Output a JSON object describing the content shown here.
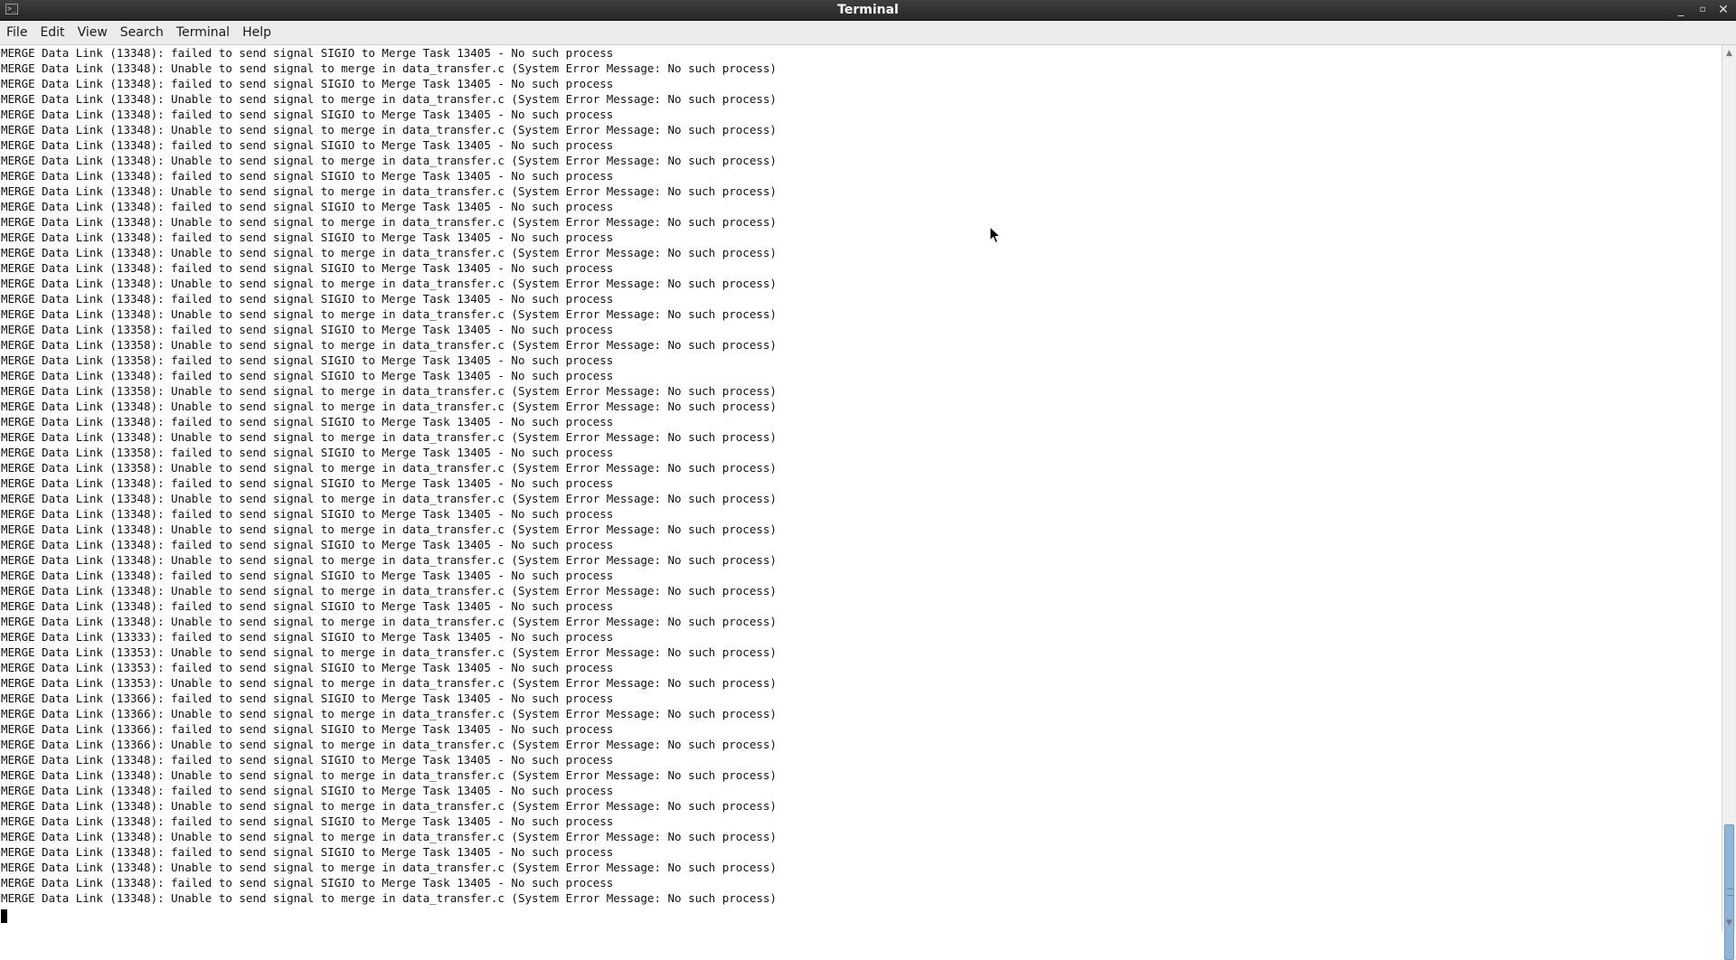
{
  "window": {
    "title": "Terminal",
    "app_icon": ">_",
    "buttons": {
      "minimize": "_",
      "maximize": "▫",
      "close": "✕"
    }
  },
  "menu": [
    "File",
    "Edit",
    "View",
    "Search",
    "Terminal",
    "Help"
  ],
  "terminal": {
    "lines": [
      "MERGE Data Link (13348): failed to send signal SIGIO to Merge Task 13405 - No such process",
      "MERGE Data Link (13348): Unable to send signal to merge in data_transfer.c (System Error Message: No such process)",
      "MERGE Data Link (13348): failed to send signal SIGIO to Merge Task 13405 - No such process",
      "MERGE Data Link (13348): Unable to send signal to merge in data_transfer.c (System Error Message: No such process)",
      "MERGE Data Link (13348): failed to send signal SIGIO to Merge Task 13405 - No such process",
      "MERGE Data Link (13348): Unable to send signal to merge in data_transfer.c (System Error Message: No such process)",
      "MERGE Data Link (13348): failed to send signal SIGIO to Merge Task 13405 - No such process",
      "MERGE Data Link (13348): Unable to send signal to merge in data_transfer.c (System Error Message: No such process)",
      "MERGE Data Link (13348): failed to send signal SIGIO to Merge Task 13405 - No such process",
      "MERGE Data Link (13348): Unable to send signal to merge in data_transfer.c (System Error Message: No such process)",
      "MERGE Data Link (13348): failed to send signal SIGIO to Merge Task 13405 - No such process",
      "MERGE Data Link (13348): Unable to send signal to merge in data_transfer.c (System Error Message: No such process)",
      "MERGE Data Link (13348): failed to send signal SIGIO to Merge Task 13405 - No such process",
      "MERGE Data Link (13348): Unable to send signal to merge in data_transfer.c (System Error Message: No such process)",
      "MERGE Data Link (13348): failed to send signal SIGIO to Merge Task 13405 - No such process",
      "MERGE Data Link (13348): Unable to send signal to merge in data_transfer.c (System Error Message: No such process)",
      "MERGE Data Link (13348): failed to send signal SIGIO to Merge Task 13405 - No such process",
      "MERGE Data Link (13348): Unable to send signal to merge in data_transfer.c (System Error Message: No such process)",
      "MERGE Data Link (13358): failed to send signal SIGIO to Merge Task 13405 - No such process",
      "MERGE Data Link (13358): Unable to send signal to merge in data_transfer.c (System Error Message: No such process)",
      "MERGE Data Link (13358): failed to send signal SIGIO to Merge Task 13405 - No such process",
      "MERGE Data Link (13348): failed to send signal SIGIO to Merge Task 13405 - No such process",
      "MERGE Data Link (13358): Unable to send signal to merge in data_transfer.c (System Error Message: No such process)",
      "MERGE Data Link (13348): Unable to send signal to merge in data_transfer.c (System Error Message: No such process)",
      "MERGE Data Link (13348): failed to send signal SIGIO to Merge Task 13405 - No such process",
      "MERGE Data Link (13348): Unable to send signal to merge in data_transfer.c (System Error Message: No such process)",
      "MERGE Data Link (13358): failed to send signal SIGIO to Merge Task 13405 - No such process",
      "MERGE Data Link (13358): Unable to send signal to merge in data_transfer.c (System Error Message: No such process)",
      "MERGE Data Link (13348): failed to send signal SIGIO to Merge Task 13405 - No such process",
      "MERGE Data Link (13348): Unable to send signal to merge in data_transfer.c (System Error Message: No such process)",
      "MERGE Data Link (13348): failed to send signal SIGIO to Merge Task 13405 - No such process",
      "MERGE Data Link (13348): Unable to send signal to merge in data_transfer.c (System Error Message: No such process)",
      "MERGE Data Link (13348): failed to send signal SIGIO to Merge Task 13405 - No such process",
      "MERGE Data Link (13348): Unable to send signal to merge in data_transfer.c (System Error Message: No such process)",
      "MERGE Data Link (13348): failed to send signal SIGIO to Merge Task 13405 - No such process",
      "MERGE Data Link (13348): Unable to send signal to merge in data_transfer.c (System Error Message: No such process)",
      "MERGE Data Link (13348): failed to send signal SIGIO to Merge Task 13405 - No such process",
      "MERGE Data Link (13348): Unable to send signal to merge in data_transfer.c (System Error Message: No such process)",
      "MERGE Data Link (13333): failed to send signal SIGIO to Merge Task 13405 - No such process",
      "MERGE Data Link (13353): Unable to send signal to merge in data_transfer.c (System Error Message: No such process)",
      "MERGE Data Link (13353): failed to send signal SIGIO to Merge Task 13405 - No such process",
      "MERGE Data Link (13353): Unable to send signal to merge in data_transfer.c (System Error Message: No such process)",
      "MERGE Data Link (13366): failed to send signal SIGIO to Merge Task 13405 - No such process",
      "MERGE Data Link (13366): Unable to send signal to merge in data_transfer.c (System Error Message: No such process)",
      "MERGE Data Link (13366): failed to send signal SIGIO to Merge Task 13405 - No such process",
      "MERGE Data Link (13366): Unable to send signal to merge in data_transfer.c (System Error Message: No such process)",
      "MERGE Data Link (13348): failed to send signal SIGIO to Merge Task 13405 - No such process",
      "MERGE Data Link (13348): Unable to send signal to merge in data_transfer.c (System Error Message: No such process)",
      "MERGE Data Link (13348): failed to send signal SIGIO to Merge Task 13405 - No such process",
      "MERGE Data Link (13348): Unable to send signal to merge in data_transfer.c (System Error Message: No such process)",
      "MERGE Data Link (13348): failed to send signal SIGIO to Merge Task 13405 - No such process",
      "MERGE Data Link (13348): Unable to send signal to merge in data_transfer.c (System Error Message: No such process)",
      "MERGE Data Link (13348): failed to send signal SIGIO to Merge Task 13405 - No such process",
      "MERGE Data Link (13348): Unable to send signal to merge in data_transfer.c (System Error Message: No such process)",
      "MERGE Data Link (13348): failed to send signal SIGIO to Merge Task 13405 - No such process",
      "MERGE Data Link (13348): Unable to send signal to merge in data_transfer.c (System Error Message: No such process)"
    ]
  },
  "scrollbar": {
    "position_fraction": 0.97,
    "visible_fraction": 0.15
  }
}
